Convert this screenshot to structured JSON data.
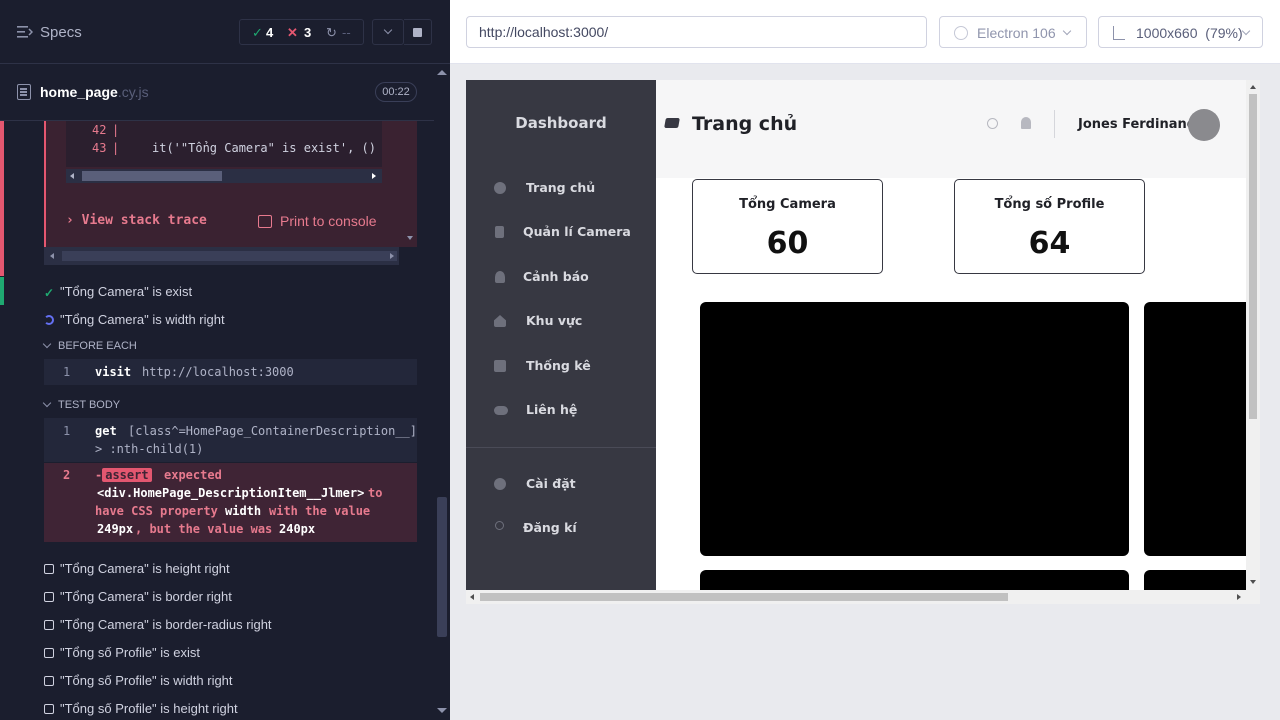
{
  "runner": {
    "specs_label": "Specs",
    "stats": {
      "passed": "4",
      "failed": "3",
      "pending": "--"
    },
    "spec_file": {
      "name": "home_page",
      "ext": ".cy.js",
      "duration": "00:22"
    },
    "error": {
      "code_lines": [
        {
          "num": "42",
          "text": ""
        },
        {
          "num": "43",
          "text": "it('\"Tổng Camera\" is exist', ()"
        }
      ],
      "view_stack_label": "View stack trace",
      "print_console_label": "Print to console"
    },
    "tests": [
      {
        "title": "\"Tổng Camera\" is exist",
        "state": "passed"
      },
      {
        "title": "\"Tổng Camera\" is width right",
        "state": "running"
      }
    ],
    "before_each": {
      "header": "BEFORE EACH",
      "commands": [
        {
          "num": "1",
          "name": "visit",
          "arg": "http://localhost:3000"
        }
      ]
    },
    "test_body": {
      "header": "TEST BODY",
      "get_cmd": {
        "num": "1",
        "name": "get",
        "arg_line1": "[class^=HomePage_ContainerDescription__]",
        "arg_line2": "> :nth-child(1)"
      },
      "assert_cmd": {
        "num": "2",
        "badge": "assert",
        "expected": "expected",
        "subject": "<div.HomePage_DescriptionItem__Jlmer>",
        "to": "to",
        "line2a": "have CSS property",
        "prop": "width",
        "line2b": "with the value",
        "value": "249px",
        "line3b": ", but the value was",
        "actual": "240px"
      }
    },
    "pending_tests": [
      "\"Tổng Camera\" is height right",
      "\"Tổng Camera\" is border right",
      "\"Tổng Camera\" is border-radius right",
      "\"Tổng số Profile\" is exist",
      "\"Tổng số Profile\" is width right",
      "\"Tổng số Profile\" is height right"
    ],
    "colors": {
      "pass": "#1fa971",
      "fail": "#e45770",
      "accent": "#6470f3"
    }
  },
  "browser_toolbar": {
    "url": "http://localhost:3000/",
    "browser": "Electron 106",
    "viewport": "1000x660",
    "scale": "(79%)"
  },
  "app": {
    "brand": "Dashboard",
    "nav": [
      {
        "label": "Trang chủ",
        "icon": "pie-chart-icon"
      },
      {
        "label": "Quản lí Camera",
        "icon": "list-icon"
      },
      {
        "label": "Cảnh báo",
        "icon": "alert-icon"
      },
      {
        "label": "Khu vực",
        "icon": "home-icon"
      },
      {
        "label": "Thống kê",
        "icon": "stats-icon"
      },
      {
        "label": "Liên hệ",
        "icon": "contacts-icon"
      },
      {
        "label": "Cài đặt",
        "icon": "gear-icon"
      },
      {
        "label": "Đăng kí",
        "icon": "user-icon"
      }
    ],
    "page_title": "Trang chủ",
    "user_name": "Jones Ferdinand",
    "stats": [
      {
        "label": "Tổng Camera",
        "value": "60"
      },
      {
        "label": "Tổng số Profile",
        "value": "64"
      }
    ]
  }
}
